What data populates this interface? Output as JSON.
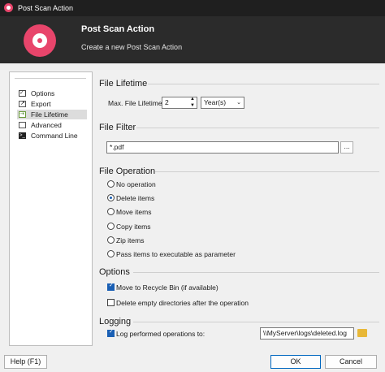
{
  "window": {
    "title": "Post Scan Action"
  },
  "header": {
    "title": "Post Scan Action",
    "subtitle": "Create a new Post Scan Action"
  },
  "sidebar": {
    "items": [
      {
        "label": "Options",
        "icon": "checklist-icon"
      },
      {
        "label": "Export",
        "icon": "export-icon"
      },
      {
        "label": "File Lifetime",
        "icon": "file-lifetime-icon",
        "selected": true
      },
      {
        "label": "Advanced",
        "icon": "advanced-icon"
      },
      {
        "label": "Command Line",
        "icon": "terminal-icon"
      }
    ]
  },
  "file_lifetime": {
    "heading": "File Lifetime",
    "max_label": "Max. File Lifetime:",
    "value": "2",
    "unit": "Year(s)"
  },
  "file_filter": {
    "heading": "File Filter",
    "value": "*.pdf",
    "browse_label": "..."
  },
  "file_operation": {
    "heading": "File Operation",
    "options": [
      {
        "label": "No operation",
        "selected": false
      },
      {
        "label": "Delete items",
        "selected": true
      },
      {
        "label": "Move items",
        "selected": false
      },
      {
        "label": "Copy items",
        "selected": false
      },
      {
        "label": "Zip items",
        "selected": false
      },
      {
        "label": "Pass items to executable as parameter",
        "selected": false
      }
    ]
  },
  "options": {
    "heading": "Options",
    "move_to_recycle_bin": {
      "label": "Move to Recycle Bin (if available)",
      "checked": true
    },
    "delete_empty_dirs": {
      "label": "Delete empty directories after the operation",
      "checked": false
    }
  },
  "logging": {
    "heading": "Logging",
    "log_label": "Log performed operations to:",
    "checked": true,
    "path": "\\\\MyServer\\logs\\deleted.log"
  },
  "footer": {
    "help_label": "Help (F1)",
    "ok_label": "OK",
    "cancel_label": "Cancel"
  },
  "colors": {
    "accent": "#e8456b",
    "header_bg": "#2b2b2b",
    "check_blue": "#1a5fb4"
  }
}
